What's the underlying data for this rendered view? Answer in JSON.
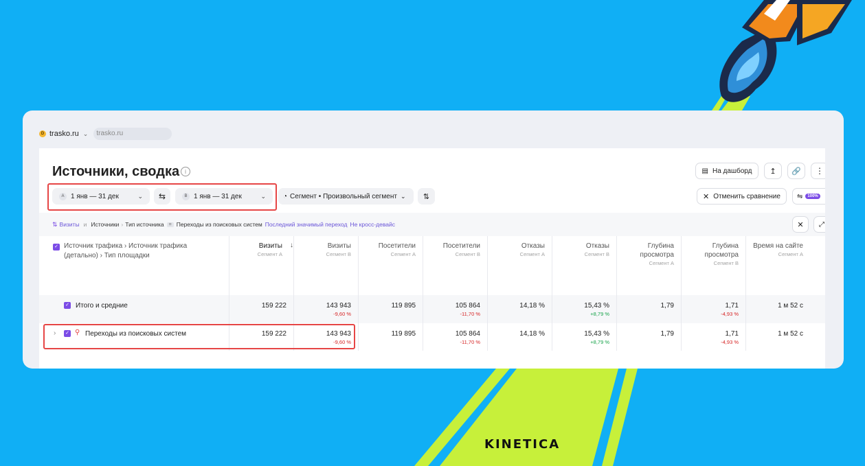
{
  "brand": "KINETICA",
  "site": {
    "icon_letter": "D",
    "name": "trasko.ru",
    "second": "trasko.ru"
  },
  "report": {
    "title": "Источники, сводка",
    "to_dashboard": "На дашборд",
    "cancel_compare": "Отменить сравнение",
    "segment_label": "Сегмент • Произвольный сегмент",
    "date_a_letter": "A",
    "date_a": "1 янв — 31 дек",
    "date_b_letter": "B",
    "date_b": "1 янв — 31 дек",
    "sample_badge": "100%"
  },
  "filter": {
    "metric": "Визиты",
    "and": "и",
    "group": "Источники",
    "dimension": "Тип источника",
    "op": "=",
    "value": "Переходы из поисковых систем",
    "attribution": "Последний значимый переход",
    "crossdevice": "Не кросс-девайс"
  },
  "table": {
    "dimension_header": "Источник трафика › Источник трафика (детально) › Тип площадки",
    "columns": [
      {
        "title": "Визиты",
        "sub": "Сегмент A",
        "sorted": true
      },
      {
        "title": "Визиты",
        "sub": "Сегмент B"
      },
      {
        "title": "Посетители",
        "sub": "Сегмент A"
      },
      {
        "title": "Посетители",
        "sub": "Сегмент B"
      },
      {
        "title": "Отказы",
        "sub": "Сегмент A"
      },
      {
        "title": "Отказы",
        "sub": "Сегмент B"
      },
      {
        "title": "Глубина просмотра",
        "sub": "Сегмент A"
      },
      {
        "title": "Глубина просмотра",
        "sub": "Сегмент B"
      },
      {
        "title": "Время на сайте",
        "sub": "Сегмент A"
      }
    ],
    "rows": [
      {
        "label": "Итого и средние",
        "cells": [
          {
            "v": "159 222"
          },
          {
            "v": "143 943",
            "d": "-9,60 %",
            "s": "neg"
          },
          {
            "v": "119 895"
          },
          {
            "v": "105 864",
            "d": "-11,70 %",
            "s": "neg"
          },
          {
            "v": "14,18 %"
          },
          {
            "v": "15,43 %",
            "d": "+8,79 %",
            "s": "pos"
          },
          {
            "v": "1,79"
          },
          {
            "v": "1,71",
            "d": "-4,93 %",
            "s": "neg"
          },
          {
            "v": "1 м 52 с"
          }
        ]
      },
      {
        "label": "Переходы из поисковых систем",
        "cells": [
          {
            "v": "159 222"
          },
          {
            "v": "143 943",
            "d": "-9,60 %",
            "s": "neg"
          },
          {
            "v": "119 895"
          },
          {
            "v": "105 864",
            "d": "-11,70 %",
            "s": "neg"
          },
          {
            "v": "14,18 %"
          },
          {
            "v": "15,43 %",
            "d": "+8,79 %",
            "s": "pos"
          },
          {
            "v": "1,79"
          },
          {
            "v": "1,71",
            "d": "-4,93 %",
            "s": "neg"
          },
          {
            "v": "1 м 52 с"
          }
        ]
      }
    ]
  },
  "colors": {
    "background": "#10aff5",
    "accent": "#7b4ce6",
    "highlight": "#e64545",
    "negative": "#d62424",
    "positive": "#17a34a",
    "stripe": "#c7f03a"
  }
}
